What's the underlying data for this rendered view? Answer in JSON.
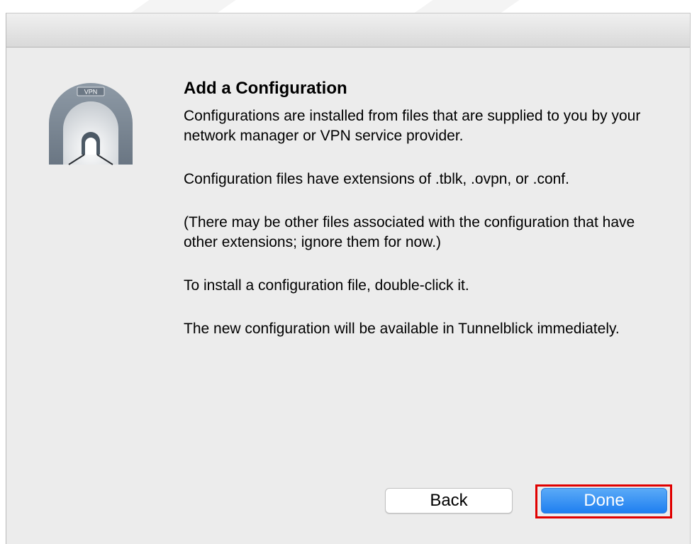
{
  "dialog": {
    "title": "Add a Configuration",
    "logo_label": "VPN",
    "paragraphs": [
      "Configurations are installed from files that are supplied to you by your network manager or VPN service provider.",
      "Configuration files have extensions of .tblk, .ovpn, or .conf.",
      "(There may be other files associated with the configuration that have other extensions; ignore them for now.)",
      "To install a configuration file, double-click it.",
      "The new configuration will be available in Tunnelblick immediately."
    ]
  },
  "buttons": {
    "back": "Back",
    "done": "Done"
  },
  "colors": {
    "accent": "#2a86f4",
    "highlight": "#e00000",
    "dialog_bg": "#ececec"
  }
}
